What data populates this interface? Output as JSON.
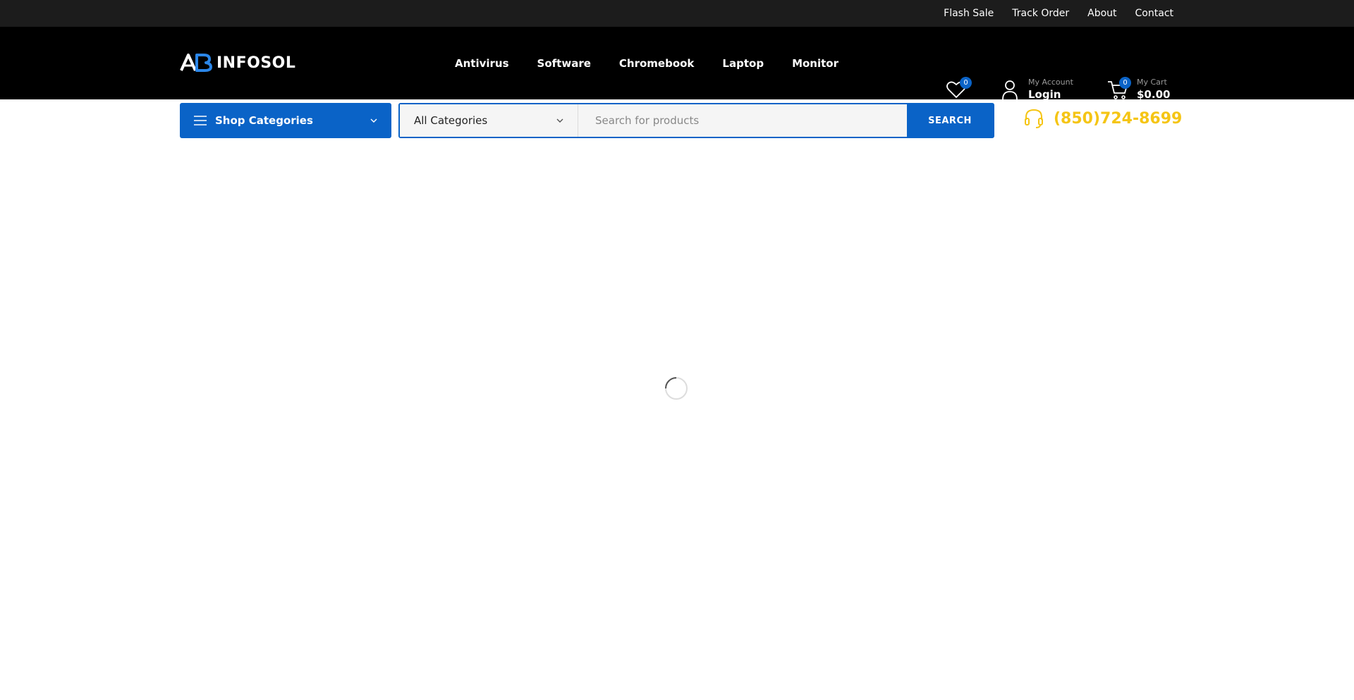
{
  "topbar": {
    "links": [
      "Flash Sale",
      "Track Order",
      "About",
      "Contact"
    ]
  },
  "header": {
    "logo_text": "INFOSOL",
    "nav": [
      "Antivirus",
      "Software",
      "Chromebook",
      "Laptop",
      "Monitor"
    ],
    "wishlist_count": "0",
    "account": {
      "small": "My Account",
      "big": "Login"
    },
    "cart": {
      "count": "0",
      "small": "My Cart",
      "big": "$0.00"
    }
  },
  "searchbar": {
    "shop_categories_label": "Shop Categories",
    "category_select": "All Categories",
    "search_placeholder": "Search for products",
    "search_button": "SEARCH",
    "phone": "(850)724-8699"
  },
  "colors": {
    "topbar_bg": "#1c1c1c",
    "header_bg": "#000000",
    "accent_blue": "#0a63c7",
    "phone_yellow": "#f5c515"
  },
  "icons": {
    "wishlist": "heart-icon",
    "account": "user-icon",
    "cart": "cart-icon",
    "menu": "hamburger-icon",
    "phone": "headset-icon",
    "loader": "spinner-icon"
  }
}
